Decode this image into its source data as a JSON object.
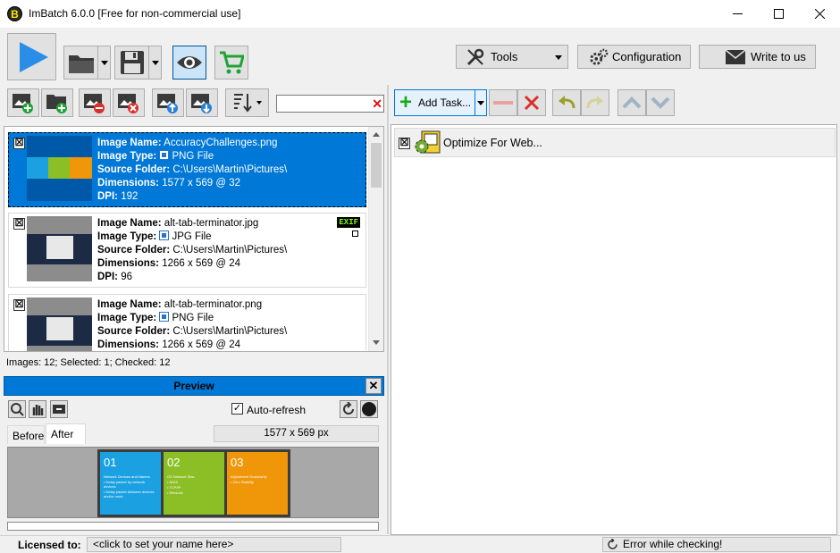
{
  "window": {
    "title": "ImBatch 6.0.0 [Free for non-commercial use]",
    "app_icon_letter": "B"
  },
  "toolbar": {
    "tools_label": "Tools",
    "configuration_label": "Configuration",
    "write_label": "Write to us"
  },
  "search": {
    "value": "",
    "clear_glyph": "✕"
  },
  "images": [
    {
      "name_label": "Image Name:",
      "name": "AccuracyChallenges.png",
      "type_label": "Image Type:",
      "type": "PNG File",
      "folder_label": "Source Folder:",
      "folder": "C:\\Users\\Martin\\Pictures\\",
      "dim_label": "Dimensions:",
      "dimensions": "1577 x 569 @ 32",
      "dpi_label": "DPI:",
      "dpi": "192",
      "checked": "☒",
      "selected": true
    },
    {
      "name_label": "Image Name:",
      "name": "alt-tab-terminator.jpg",
      "type_label": "Image Type:",
      "type": "JPG File",
      "folder_label": "Source Folder:",
      "folder": "C:\\Users\\Martin\\Pictures\\",
      "dim_label": "Dimensions:",
      "dimensions": "1266 x 569 @ 24",
      "dpi_label": "DPI:",
      "dpi": "96",
      "checked": "☒",
      "exif": "EXIF"
    },
    {
      "name_label": "Image Name:",
      "name": "alt-tab-terminator.png",
      "type_label": "Image Type:",
      "type": "PNG File",
      "folder_label": "Source Folder:",
      "folder": "C:\\Users\\Martin\\Pictures\\",
      "dim_label": "Dimensions:",
      "dimensions": "1266 x 569 @ 24",
      "checked": "☒"
    }
  ],
  "list_status": "Images: 12; Selected: 1; Checked: 12",
  "preview": {
    "title": "Preview",
    "close_glyph": "✕",
    "auto_refresh_label": "Auto-refresh",
    "tabs": [
      "Before",
      "After"
    ],
    "active_tab": "After",
    "size_readout": "1577 x 569 px",
    "tiles": [
      {
        "num": "01",
        "color": "#1ba1e2",
        "title": "Network Devices and Names",
        "b1": "• Delay packet by network devices",
        "b2": "• Delay packet between devices and/or route"
      },
      {
        "num": "02",
        "color": "#8cbf26",
        "title": "OS Network Stac",
        "b1": "• NDIS",
        "b2": "• TCP/IP",
        "b3": "• Winsock"
      },
      {
        "num": "03",
        "color": "#f09609",
        "title": "Adjustment Granularity",
        "b1": "• Zero Stability"
      }
    ]
  },
  "tasks": {
    "add_task_label": "Add Task...",
    "items": [
      {
        "label": "Optimize For Web...",
        "checked": "☒"
      }
    ]
  },
  "status": {
    "licensed_label": "Licensed to:",
    "licensed_value": "<click to set your name here>",
    "error_text": "Error while checking!"
  },
  "colors": {
    "accent": "#0078d7",
    "cart_green": "#1fa337",
    "play_blue": "#2a8ee8"
  }
}
